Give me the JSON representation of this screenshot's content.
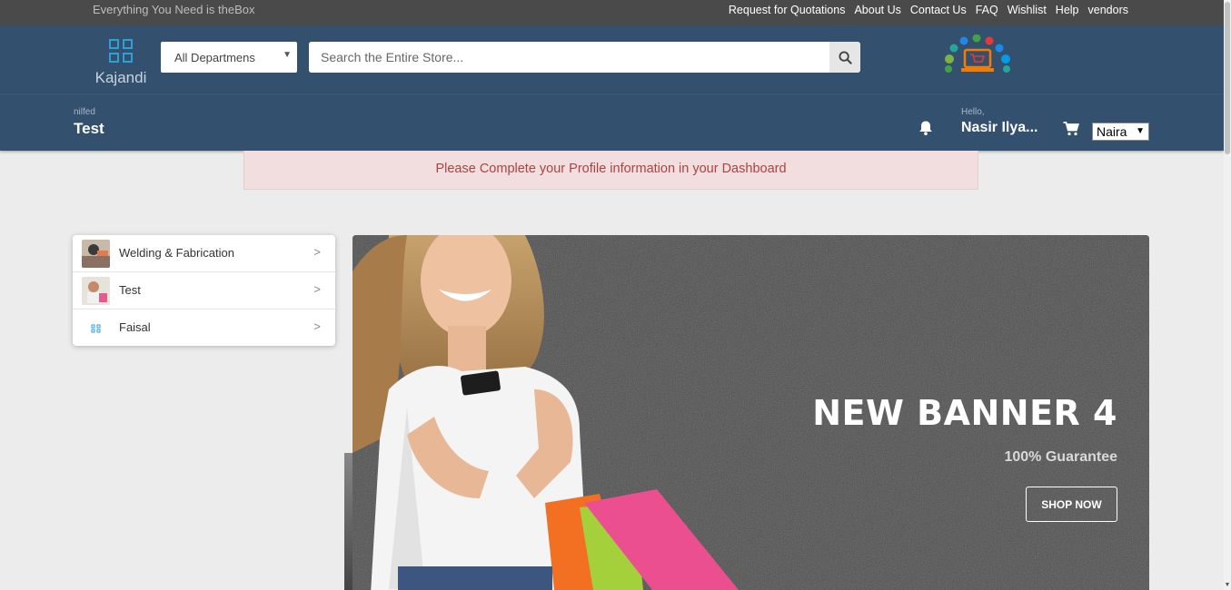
{
  "topbar": {
    "tagline": "Everything You Need is theBox",
    "links": [
      "Request for Quotations",
      "About Us",
      "Contact Us",
      "FAQ",
      "Wishlist",
      "Help",
      "vendors"
    ]
  },
  "header": {
    "logo_text": "Kajandi",
    "department_select": "All Departmens",
    "search_placeholder": "Search the Entire Store...",
    "search_icon": "search-icon",
    "promo_icon": "shopping-laptop-icon"
  },
  "subheader": {
    "store_small": "nilfed",
    "store_name": "Test",
    "bell_icon": "bell-icon",
    "hello": "Hello,",
    "user_name": "Nasir Ilya...",
    "cart_icon": "cart-icon",
    "currency": "Naira"
  },
  "alert": {
    "message": "Please Complete your Profile information in your Dashboard"
  },
  "categories": [
    {
      "label": "Welding & Fabrication",
      "chevron": ">"
    },
    {
      "label": "Test",
      "chevron": ">"
    },
    {
      "label": "Faisal",
      "chevron": ">"
    }
  ],
  "banner": {
    "title": "NEW BANNER 4",
    "subtitle": "100% Guarantee",
    "button": "SHOP NOW"
  },
  "colors": {
    "topbar": "#4a4a4a",
    "header": "#33506f",
    "alert_bg": "#f2dede",
    "alert_text": "#a94442"
  }
}
